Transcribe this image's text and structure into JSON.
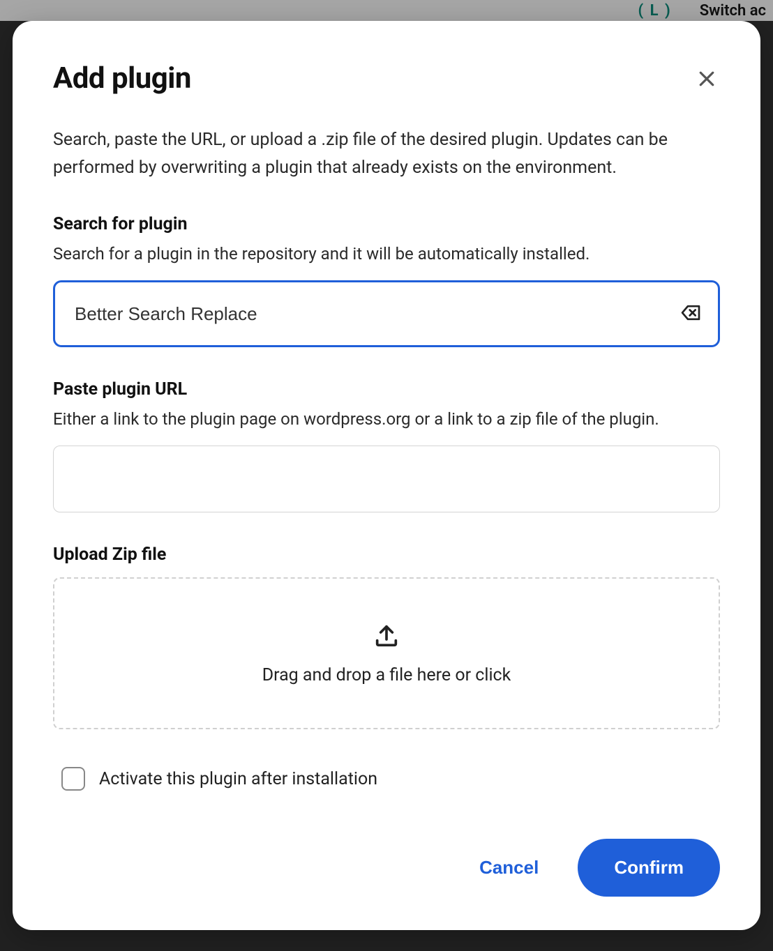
{
  "background": {
    "teal_text": "( L )",
    "switch_text": "Switch ac"
  },
  "modal": {
    "title": "Add plugin",
    "description": "Search, paste the URL, or upload a .zip file of the desired plugin. Updates can be performed by overwriting a plugin that already exists on the environment.",
    "search": {
      "title": "Search for plugin",
      "subtitle": "Search for a plugin in the repository and it will be automatically installed.",
      "value": "Better Search Replace"
    },
    "url": {
      "title": "Paste plugin URL",
      "subtitle": "Either a link to the plugin page on wordpress.org or a link to a zip file of the plugin.",
      "value": ""
    },
    "upload": {
      "title": "Upload Zip file",
      "dropzone_text": "Drag and drop a file here or click"
    },
    "activate": {
      "label": "Activate this plugin after installation",
      "checked": false
    },
    "footer": {
      "cancel": "Cancel",
      "confirm": "Confirm"
    }
  }
}
